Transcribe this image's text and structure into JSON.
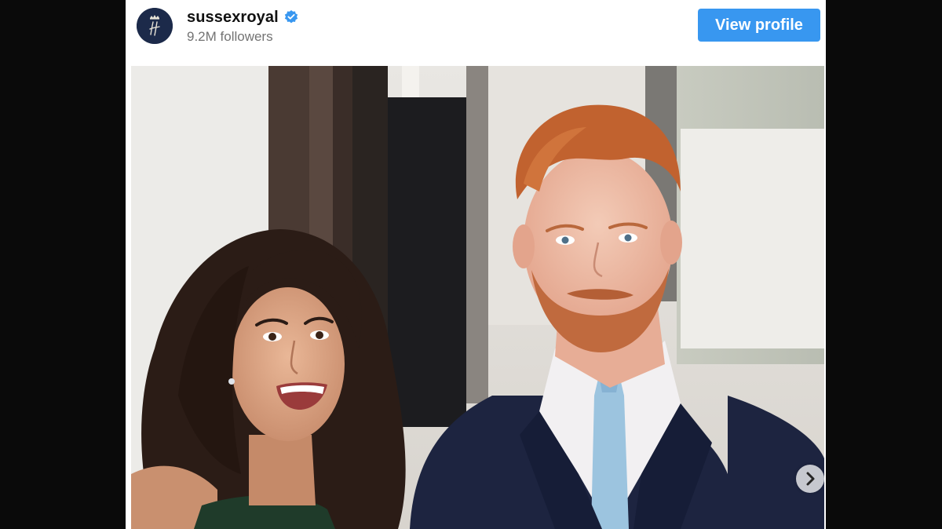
{
  "account": {
    "username": "sussexroyal",
    "followers": "9.2M followers",
    "verified": true,
    "avatar_monogram": "H"
  },
  "actions": {
    "view_profile_label": "View profile"
  },
  "post": {
    "carousel_next_icon": "chevron-right-icon"
  },
  "colors": {
    "brand_blue": "#3897f0",
    "verified_blue": "#3897f0",
    "avatar_bg": "#1c2a4a"
  }
}
